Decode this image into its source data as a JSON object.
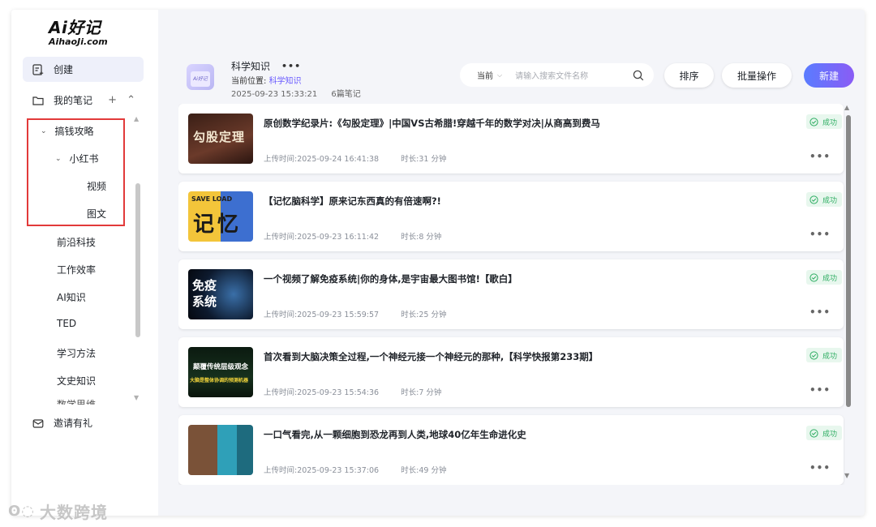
{
  "logo": {
    "main": "Ai好记",
    "sub": "AihaoJi.com"
  },
  "sidebar": {
    "create": "创建",
    "my_notes": "我的笔记",
    "my_notes_actions": "+ ⌃",
    "tree": [
      {
        "label": "搞钱攻略",
        "chevron": "⌄"
      },
      {
        "label": "小红书",
        "chevron": "⌄"
      },
      {
        "label": "视频"
      },
      {
        "label": "图文"
      },
      {
        "label": "前沿科技"
      },
      {
        "label": "工作效率"
      },
      {
        "label": "AI知识"
      },
      {
        "label": "TED"
      },
      {
        "label": "学习方法"
      },
      {
        "label": "文史知识"
      }
    ],
    "cutoff_item": "数学思维",
    "invite": "邀请有礼"
  },
  "header": {
    "folder_icon_text": "Ai好记",
    "title": "科学知识",
    "title_more": "•••",
    "location_label": "当前位置:",
    "location_value": "科学知识",
    "timestamp": "2025-09-23 15:33:21",
    "note_count": "6篇笔记"
  },
  "search": {
    "scope": "当前",
    "placeholder": "请输入搜索文件名称"
  },
  "buttons": {
    "sort": "排序",
    "batch": "批量操作",
    "new": "新建"
  },
  "notes": [
    {
      "title": "原创数学纪录片:《勾股定理》|中国VS古希腊!穿越千年的数学对决|从商高到费马",
      "upload_time": "上传时间:2025-09-24 16:41:38",
      "duration": "时长:31 分钟",
      "status": "成功",
      "thumb_text": "勾股定理"
    },
    {
      "title": "【记忆脑科学】原来记东西真的有倍速啊?!",
      "upload_time": "上传时间:2025-09-23 16:11:42",
      "duration": "时长:8 分钟",
      "status": "成功",
      "thumb_text": "记忆",
      "thumb_sub": "SAVE  LOAD"
    },
    {
      "title": "一个视频了解免疫系统|你的身体,是宇宙最大图书馆!【歌白】",
      "upload_time": "上传时间:2025-09-23 15:59:57",
      "duration": "时长:25 分钟",
      "status": "成功",
      "thumb_text": "免疫系统"
    },
    {
      "title": "首次看到大脑决策全过程,一个神经元接一个神经元的那种,【科学快报第233期】",
      "upload_time": "上传时间:2025-09-23 15:54:36",
      "duration": "时长:7 分钟",
      "status": "成功",
      "thumb_text": "颠覆传统层级观念",
      "thumb_sub": "大脑是整体协调的预测机器"
    },
    {
      "title": "一口气看完,从一颗细胞到恐龙再到人类,地球40亿年生命进化史",
      "upload_time": "上传时间:2025-09-23 15:37:06",
      "duration": "时长:49 分钟",
      "status": "成功",
      "thumb_text": ""
    }
  ],
  "watermark": "大数跨境",
  "colors": {
    "accent": "#6b5cff",
    "success": "#2fae63",
    "highlight_box": "#e23a3a"
  }
}
